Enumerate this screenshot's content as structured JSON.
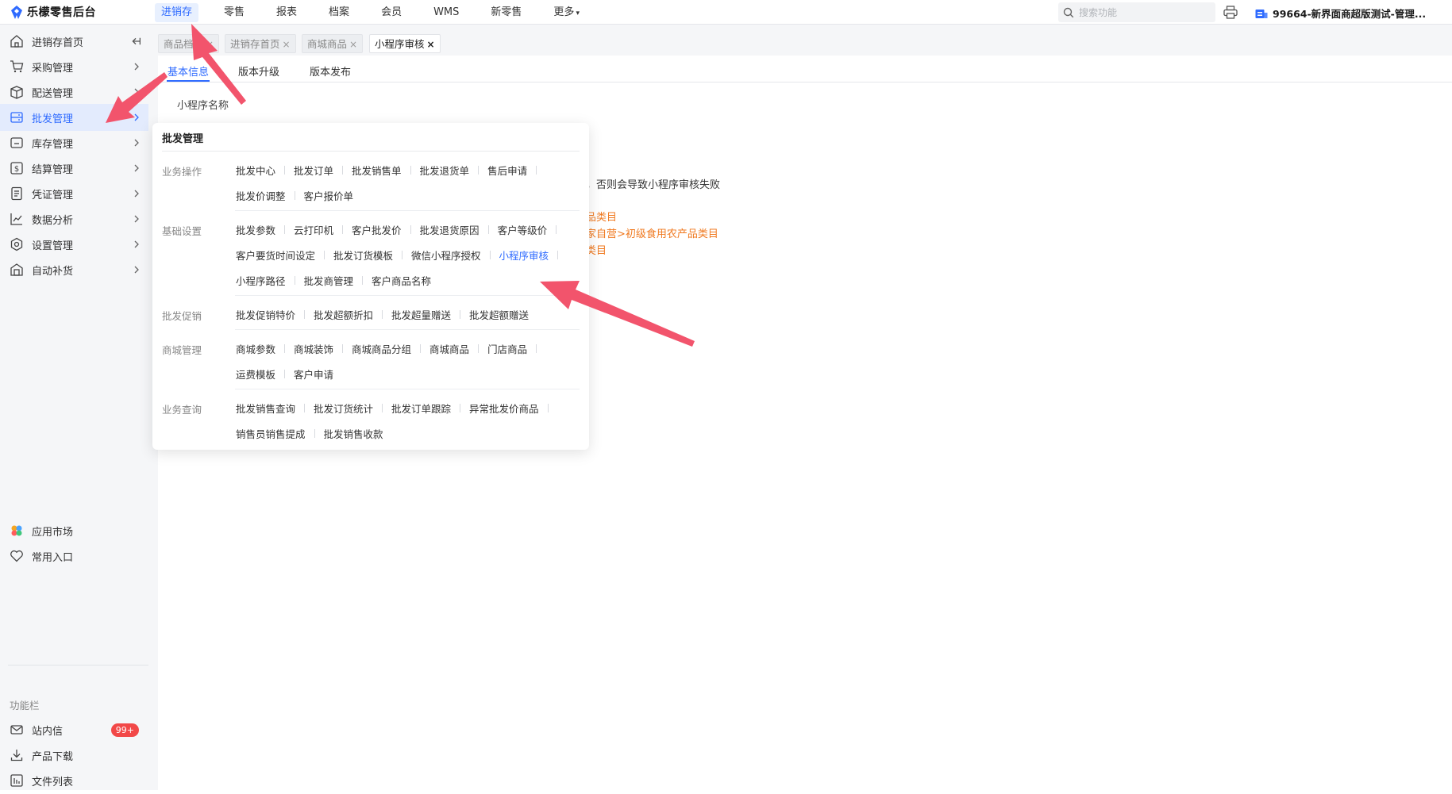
{
  "app": {
    "logo_text": "乐檬零售后台"
  },
  "topnav": [
    {
      "label": "进销存",
      "active": true
    },
    {
      "label": "零售"
    },
    {
      "label": "报表"
    },
    {
      "label": "档案"
    },
    {
      "label": "会员"
    },
    {
      "label": "WMS"
    },
    {
      "label": "新零售"
    },
    {
      "label": "更多"
    }
  ],
  "search": {
    "placeholder": "搜索功能"
  },
  "store": {
    "name": "99664-新界面商超版测试-管理..."
  },
  "sidebar": {
    "items": [
      {
        "label": "进销存首页",
        "icon": "home-icon"
      },
      {
        "label": "采购管理",
        "icon": "cart-icon"
      },
      {
        "label": "配送管理",
        "icon": "delivery-box-icon"
      },
      {
        "label": "批发管理",
        "icon": "wholesale-icon",
        "active": true
      },
      {
        "label": "库存管理",
        "icon": "inventory-icon"
      },
      {
        "label": "结算管理",
        "icon": "dollar-icon"
      },
      {
        "label": "凭证管理",
        "icon": "voucher-icon"
      },
      {
        "label": "数据分析",
        "icon": "chart-line-icon"
      },
      {
        "label": "设置管理",
        "icon": "settings-icon"
      },
      {
        "label": "自动补货",
        "icon": "replenish-icon"
      }
    ],
    "bottom": [
      {
        "label": "应用市场",
        "icon": "app-market-icon"
      },
      {
        "label": "常用入口",
        "icon": "heart-icon"
      }
    ],
    "section_label": "功能栏",
    "tools": [
      {
        "label": "站内信",
        "icon": "mail-icon",
        "badge": "99+"
      },
      {
        "label": "产品下载",
        "icon": "download-icon"
      },
      {
        "label": "文件列表",
        "icon": "file-list-icon"
      }
    ]
  },
  "tabs": [
    {
      "label": "商品档案"
    },
    {
      "label": "进销存首页"
    },
    {
      "label": "商城商品"
    },
    {
      "label": "小程序审核",
      "active": true
    }
  ],
  "main": {
    "subtabs": [
      "基本信息",
      "版本升级",
      "版本发布"
    ],
    "field_label": "小程序名称",
    "notice": "，否则会导致小程序审核失败",
    "orange_lines": [
      "品类目",
      "家自营>初级食用农产品类目",
      "类目"
    ]
  },
  "panel": {
    "title": "批发管理",
    "groups": [
      {
        "label": "业务操作",
        "rows": [
          [
            "批发中心",
            "批发订单",
            "批发销售单",
            "批发退货单",
            "售后申请"
          ],
          [
            "批发价调整",
            "客户报价单"
          ]
        ]
      },
      {
        "label": "基础设置",
        "rows": [
          [
            "批发参数",
            "云打印机",
            "客户批发价",
            "批发退货原因",
            "客户等级价"
          ],
          [
            "客户要货时间设定",
            "批发订货模板",
            "微信小程序授权",
            "小程序审核"
          ],
          [
            "小程序路径",
            "批发商管理",
            "客户商品名称"
          ]
        ]
      },
      {
        "label": "批发促销",
        "rows": [
          [
            "批发促销特价",
            "批发超额折扣",
            "批发超量赠送",
            "批发超额赠送"
          ]
        ]
      },
      {
        "label": "商城管理",
        "rows": [
          [
            "商城参数",
            "商城装饰",
            "商城商品分组",
            "商城商品",
            "门店商品"
          ],
          [
            "运费模板",
            "客户申请"
          ]
        ]
      },
      {
        "label": "业务查询",
        "rows": [
          [
            "批发销售查询",
            "批发订货统计",
            "批发订单跟踪",
            "异常批发价商品"
          ],
          [
            "销售员销售提成",
            "批发销售收款"
          ]
        ]
      }
    ],
    "current": "小程序审核"
  },
  "colors": {
    "accent": "#2f6bff",
    "annotation_arrow": "#f2546c",
    "warning_text": "#f07a21",
    "badge": "#f24848"
  }
}
